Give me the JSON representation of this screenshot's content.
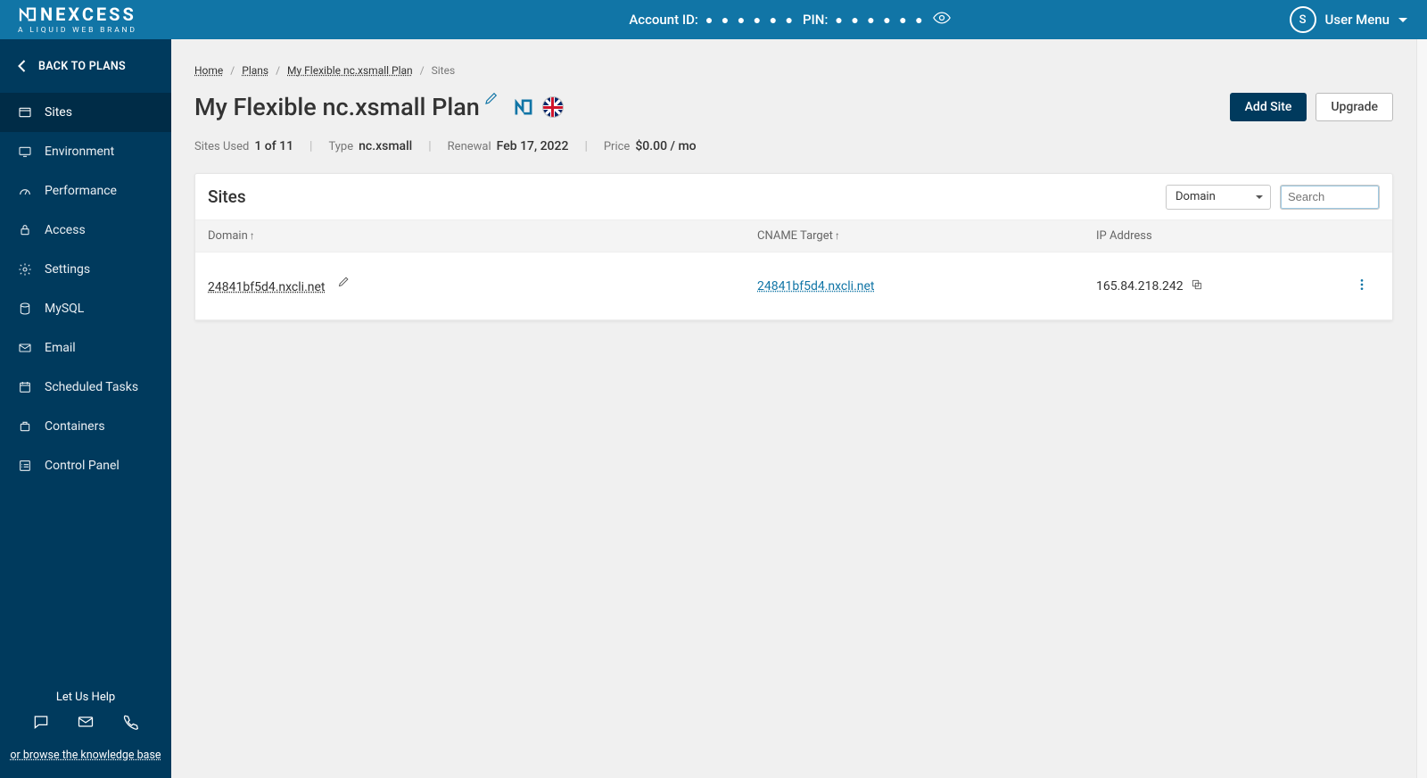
{
  "brand": {
    "name": "NEXCESS",
    "sub": "A LIQUID WEB BRAND"
  },
  "topbar": {
    "account_label": "Account ID:",
    "account_mask": "● ● ● ● ● ●",
    "pin_label": "PIN:",
    "pin_mask": "● ● ● ● ● ●",
    "avatar_letter": "S",
    "user_menu_label": "User Menu"
  },
  "sidebar": {
    "back_label": "BACK TO PLANS",
    "items": [
      {
        "label": "Sites"
      },
      {
        "label": "Environment"
      },
      {
        "label": "Performance"
      },
      {
        "label": "Access"
      },
      {
        "label": "Settings"
      },
      {
        "label": "MySQL"
      },
      {
        "label": "Email"
      },
      {
        "label": "Scheduled Tasks"
      },
      {
        "label": "Containers"
      },
      {
        "label": "Control Panel"
      }
    ],
    "help_title": "Let Us Help",
    "kb_link": "or browse the knowledge base"
  },
  "breadcrumb": {
    "home": "Home",
    "plans": "Plans",
    "plan_name": "My Flexible nc.xsmall Plan",
    "current": "Sites"
  },
  "title_row": {
    "title": "My Flexible nc.xsmall Plan",
    "add_site": "Add Site",
    "upgrade": "Upgrade"
  },
  "meta": {
    "sites_used_label": "Sites Used",
    "sites_used_value": "1 of 11",
    "type_label": "Type",
    "type_value": "nc.xsmall",
    "renewal_label": "Renewal",
    "renewal_value": "Feb 17, 2022",
    "price_label": "Price",
    "price_value": "$0.00 / mo"
  },
  "card": {
    "title": "Sites",
    "filter_by": "Domain",
    "search_placeholder": "Search"
  },
  "table": {
    "domain_header": "Domain",
    "cname_header": "CNAME Target",
    "ip_header": "IP Address",
    "rows": [
      {
        "domain": "24841bf5d4.nxcli.net",
        "cname": "24841bf5d4.nxcli.net",
        "ip": "165.84.218.242"
      }
    ]
  }
}
